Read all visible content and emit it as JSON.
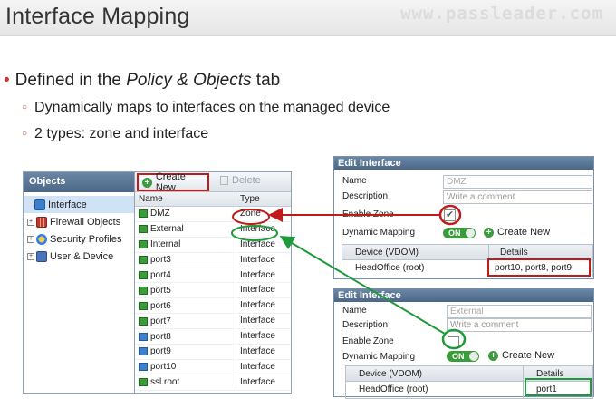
{
  "slide": {
    "title": "Interface Mapping",
    "watermark": "www.passleader.com",
    "bullet_main_prefix": "Defined in the ",
    "bullet_main_em": "Policy & Objects",
    "bullet_main_suffix": " tab",
    "sub_bullets": [
      "Dynamically maps to interfaces on the managed device",
      "2 types: zone and interface"
    ]
  },
  "objects_panel": {
    "header": "Objects",
    "items": [
      {
        "label": "Interface",
        "icon": "interface-icon",
        "selected": true
      },
      {
        "label": "Firewall Objects",
        "icon": "firewall-icon",
        "expandable": true
      },
      {
        "label": "Security Profiles",
        "icon": "security-icon",
        "expandable": true
      },
      {
        "label": "User & Device",
        "icon": "user-icon",
        "expandable": true
      }
    ]
  },
  "list_panel": {
    "create_label": "Create New",
    "delete_label": "Delete",
    "col_name": "Name",
    "col_type": "Type",
    "rows": [
      {
        "name": "DMZ",
        "type": "Zone",
        "icon": "green"
      },
      {
        "name": "External",
        "type": "Interface",
        "icon": "green"
      },
      {
        "name": "Internal",
        "type": "Interface",
        "icon": "green"
      },
      {
        "name": "port3",
        "type": "Interface",
        "icon": "green"
      },
      {
        "name": "port4",
        "type": "Interface",
        "icon": "green"
      },
      {
        "name": "port5",
        "type": "Interface",
        "icon": "green"
      },
      {
        "name": "port6",
        "type": "Interface",
        "icon": "green"
      },
      {
        "name": "port7",
        "type": "Interface",
        "icon": "green"
      },
      {
        "name": "port8",
        "type": "Interface",
        "icon": "blue"
      },
      {
        "name": "port9",
        "type": "Interface",
        "icon": "blue"
      },
      {
        "name": "port10",
        "type": "Interface",
        "icon": "blue"
      },
      {
        "name": "ssl.root",
        "type": "Interface",
        "icon": "green"
      }
    ]
  },
  "dialog_zone": {
    "title": "Edit Interface",
    "name_label": "Name",
    "name_value": "DMZ",
    "desc_label": "Description",
    "desc_placeholder": "Write a comment",
    "zone_label": "Enable Zone",
    "zone_checked": true,
    "dm_label": "Dynamic Mapping",
    "toggle_label": "ON",
    "create_label": "Create New",
    "col_device": "Device (VDOM)",
    "col_details": "Details",
    "row_device": "HeadOffice (root)",
    "row_details": "port10, port8, port9"
  },
  "dialog_iface": {
    "title": "Edit Interface",
    "name_label": "Name",
    "name_value": "External",
    "desc_label": "Description",
    "desc_placeholder": "Write a comment",
    "zone_label": "Enable Zone",
    "zone_checked": false,
    "dm_label": "Dynamic Mapping",
    "toggle_label": "ON",
    "create_label": "Create New",
    "col_device": "Device (VDOM)",
    "col_details": "Details",
    "row_device": "HeadOffice (root)",
    "row_details": "port1"
  },
  "colors": {
    "highlight_red": "#c01a1a",
    "highlight_green": "#1f9a3a",
    "header_blue": "#5b7797",
    "bullet_red": "#c0392b"
  }
}
